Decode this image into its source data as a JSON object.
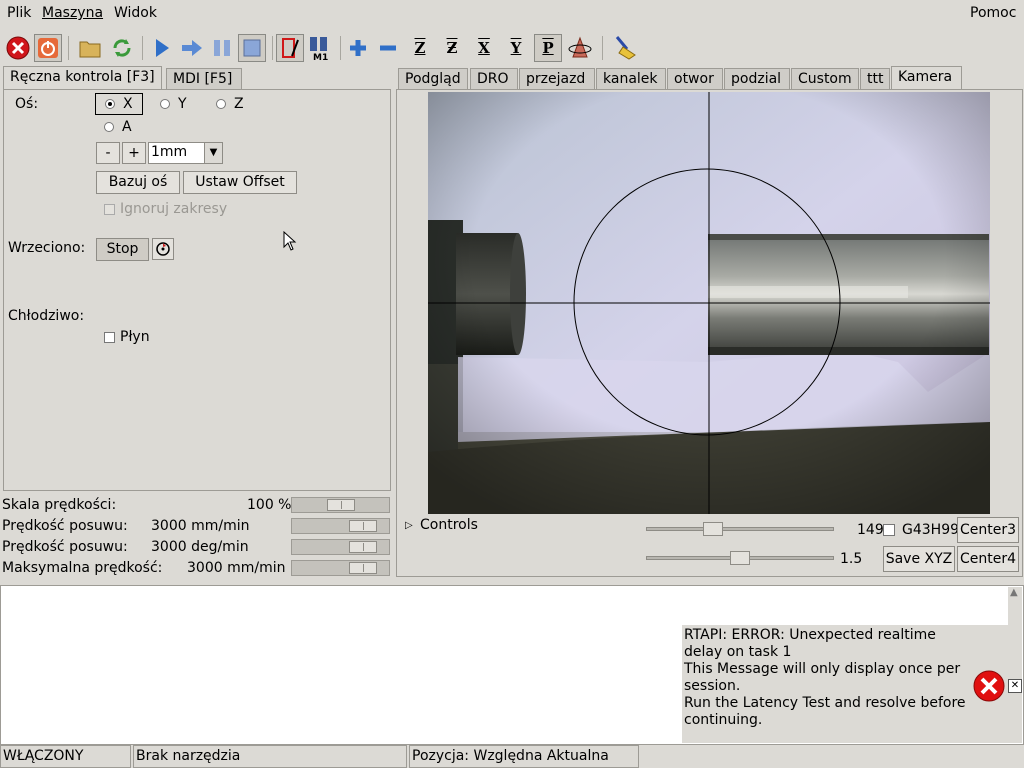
{
  "menubar": {
    "items": [
      {
        "label": "Plik"
      },
      {
        "label": "Maszyna"
      },
      {
        "label": "Widok"
      }
    ],
    "help": "Pomoc"
  },
  "toolbar": {
    "buttons": [
      {
        "name": "estop-icon",
        "glyph": "✕"
      },
      {
        "name": "power-icon",
        "glyph": "⏻"
      },
      {
        "name": "open-folder-icon",
        "glyph": "▬"
      },
      {
        "name": "reload-icon",
        "glyph": "⟳"
      },
      {
        "name": "run-icon",
        "glyph": "▶"
      },
      {
        "name": "step-icon",
        "glyph": "➔"
      },
      {
        "name": "pause-icon",
        "glyph": "❚❚"
      },
      {
        "name": "stop-icon",
        "glyph": "■"
      },
      {
        "name": "block-delete-icon",
        "glyph": "/"
      },
      {
        "name": "optional-stop-icon",
        "glyph": "M1"
      },
      {
        "name": "zoom-in-icon",
        "glyph": "+"
      },
      {
        "name": "zoom-out-icon",
        "glyph": "−"
      },
      {
        "name": "view-z-icon",
        "glyph": "Z"
      },
      {
        "name": "view-z2-icon",
        "glyph": "Z"
      },
      {
        "name": "view-x-icon",
        "glyph": "X"
      },
      {
        "name": "view-y-icon",
        "glyph": "Y"
      },
      {
        "name": "view-p-icon",
        "glyph": "P"
      },
      {
        "name": "rotate-icon",
        "glyph": "▲"
      },
      {
        "name": "clear-plot-icon",
        "glyph": "✎"
      }
    ]
  },
  "left_tabs": [
    {
      "label": "Ręczna kontrola [F3]"
    },
    {
      "label": "MDI [F5]"
    }
  ],
  "manual": {
    "axis_label": "Oś:",
    "axes": [
      "X",
      "Y",
      "Z",
      "A"
    ],
    "selected_axis": "X",
    "minus": "-",
    "plus": "+",
    "increment": "1mm",
    "home_button": "Bazuj oś",
    "offset_button": "Ustaw Offset",
    "ignore_limits": "Ignoruj zakresy",
    "spindle_label": "Wrzeciono:",
    "spindle_stop": "Stop",
    "coolant_label": "Chłodziwo:",
    "flood": "Płyn"
  },
  "overrides": [
    {
      "label": "Skala prędkości:",
      "value": "100 %",
      "fraction": 0.5
    },
    {
      "label": "Prędkość posuwu:",
      "value": "3000 mm/min",
      "fraction": 0.83
    },
    {
      "label": "Prędkość posuwu:",
      "value": "3000 deg/min",
      "fraction": 0.83
    },
    {
      "label": "Maksymalna prędkość:",
      "value": "3000 mm/min",
      "fraction": 0.83
    }
  ],
  "right_tabs": [
    {
      "label": "Podgląd"
    },
    {
      "label": "DRO"
    },
    {
      "label": "przejazd"
    },
    {
      "label": "kanalek"
    },
    {
      "label": "otwor"
    },
    {
      "label": "podzial"
    },
    {
      "label": "Custom"
    },
    {
      "label": "ttt"
    },
    {
      "label": "Kamera"
    }
  ],
  "camera": {
    "controls_label": "Controls",
    "slider1_value": "149",
    "slider1_fraction": 0.34,
    "slider2_value": "1.5",
    "slider2_fraction": 0.5,
    "g43_label": "G43H99",
    "center3": "Center3",
    "center4": "Center4",
    "save_xyz": "Save XYZ"
  },
  "notification": {
    "lines": [
      "RTAPI: ERROR: Unexpected realtime",
      "delay on task 1",
      "This Message will only display once per",
      "session.",
      "Run the Latency Test and resolve before",
      "continuing."
    ]
  },
  "statusbar": {
    "state": "WŁĄCZONY",
    "tool": "Brak narzędzia",
    "position": "Pozycja: Względna Aktualna"
  }
}
